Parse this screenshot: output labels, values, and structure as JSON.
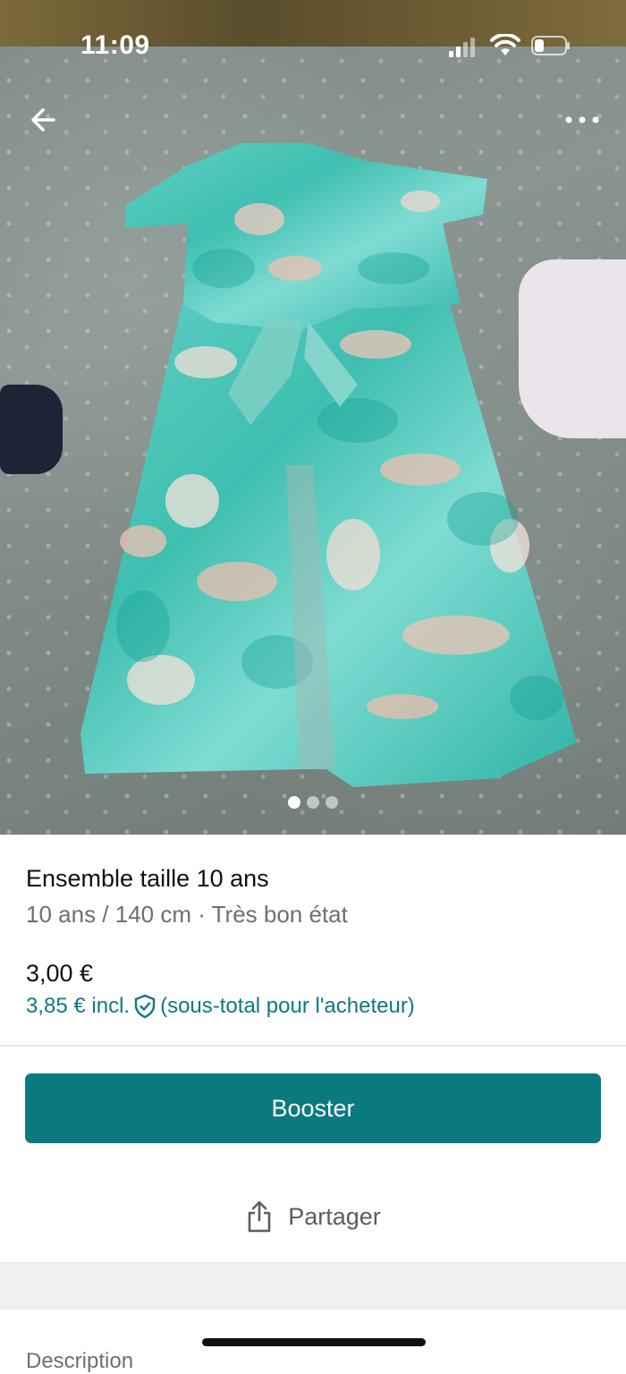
{
  "status_bar": {
    "time": "11:09"
  },
  "gallery": {
    "image_count": 3,
    "active_index": 0
  },
  "listing": {
    "title": "Ensemble taille 10 ans",
    "subtitle": "10 ans / 140 cm · Très bon état",
    "price": "3,00 €",
    "price_incl": "3,85 € incl.",
    "price_incl_note": "(sous-total pour l'acheteur)"
  },
  "actions": {
    "booster_label": "Booster",
    "share_label": "Partager"
  },
  "description": {
    "label": "Description"
  },
  "colors": {
    "accent": "#0b7a80",
    "link": "#0d7a80"
  },
  "icons": [
    "back-arrow-icon",
    "more-dots-icon",
    "shield-check-icon",
    "share-icon"
  ]
}
